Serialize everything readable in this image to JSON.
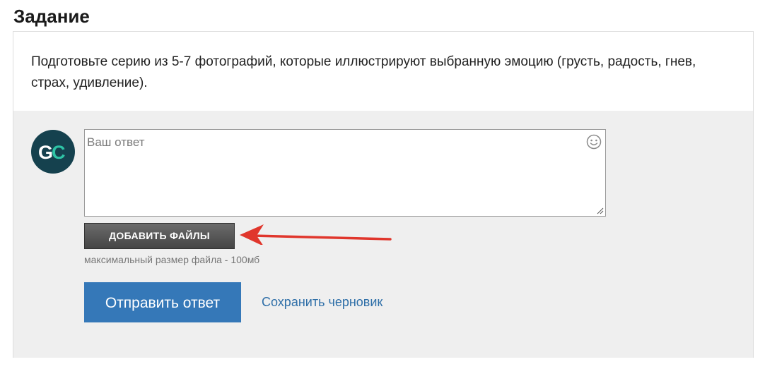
{
  "page": {
    "title": "Задание"
  },
  "task": {
    "text": "Подготовьте серию из 5-7 фотографий, которые иллюстрируют выбранную эмоцию (грусть, радость, гнев, страх, удивление)."
  },
  "answer": {
    "avatar_initials": "GC",
    "avatar_icon": "gc-logo",
    "placeholder": "Ваш ответ",
    "value": "",
    "emoji_icon": "smiley-icon",
    "add_files_label": "ДОБАВИТЬ ФАЙЛЫ",
    "file_size_hint": "максимальный размер файла - 100мб",
    "submit_label": "Отправить ответ",
    "save_draft_label": "Сохранить черновик"
  },
  "colors": {
    "avatar_bg": "#15414e",
    "avatar_accent": "#2ec4a6",
    "submit_bg": "#3578b8",
    "link": "#2f6fa8",
    "answer_area_bg": "#efefef",
    "arrow": "#e0362c"
  }
}
